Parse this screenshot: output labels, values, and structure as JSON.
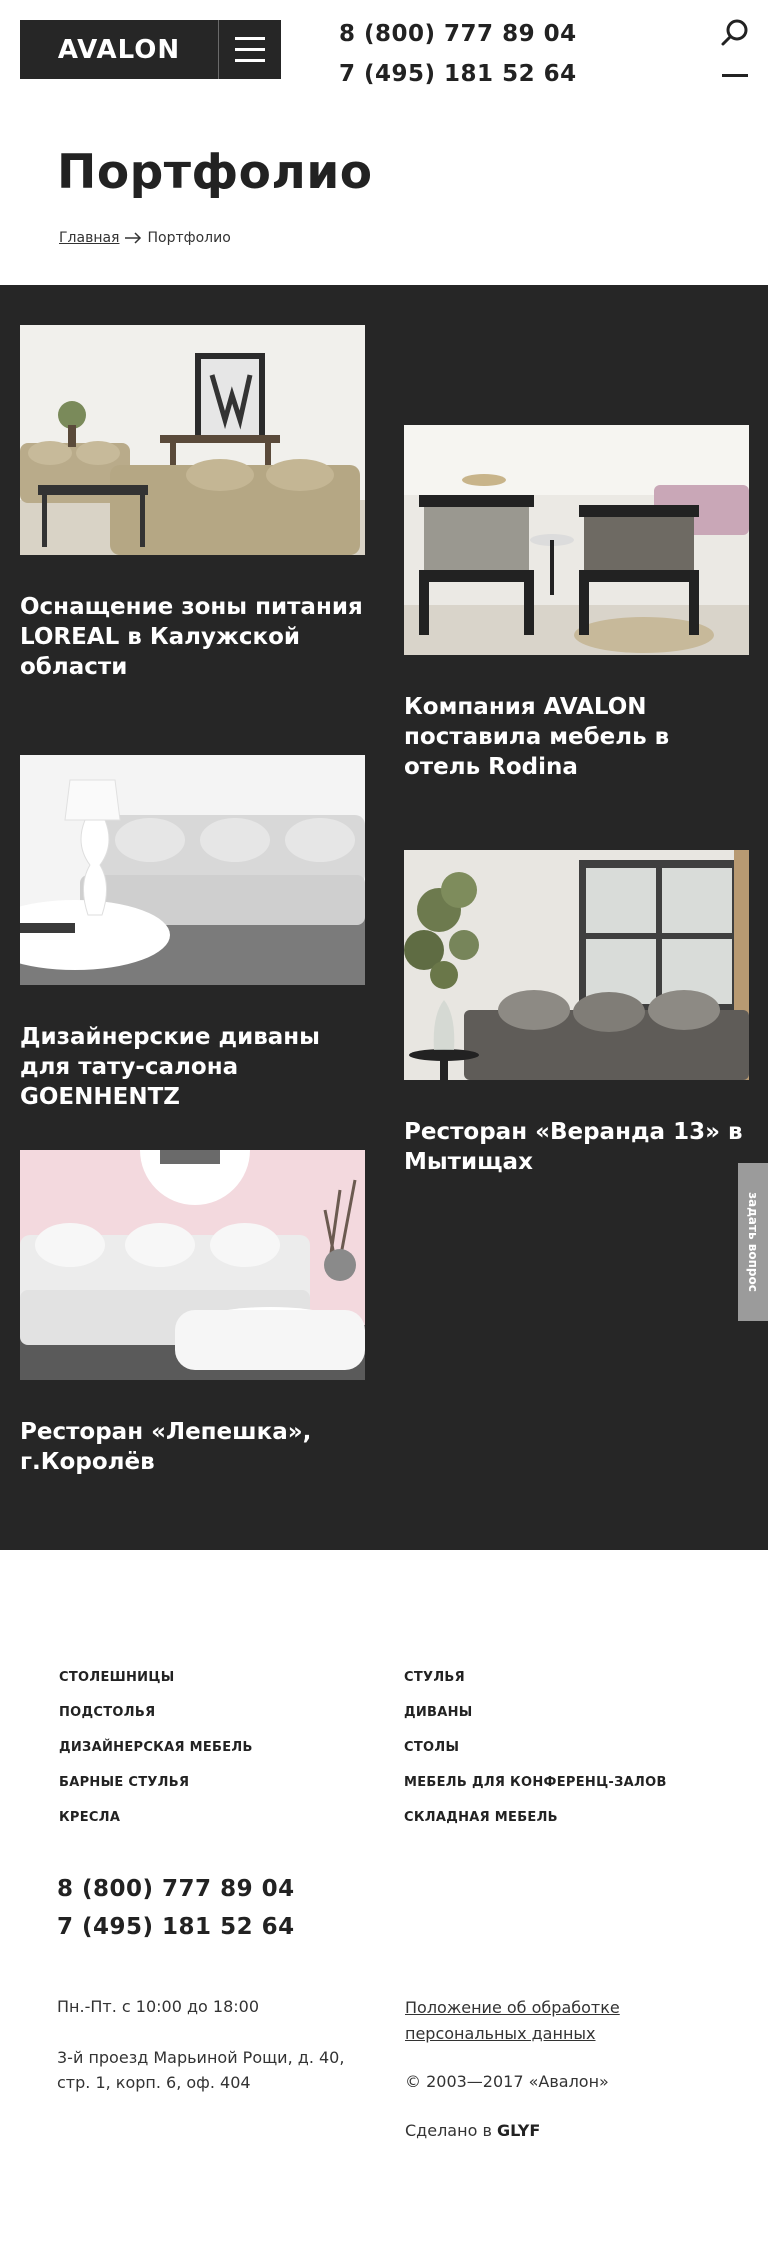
{
  "header": {
    "logo": "AVALON",
    "phones": [
      "8 (800) 777 89 04",
      "7 (495) 181 52 64"
    ],
    "icons": [
      "menu-icon",
      "search-icon"
    ]
  },
  "page": {
    "title": "Портфолио",
    "breadcrumb": {
      "home": "Главная",
      "current": "Портфолио"
    }
  },
  "portfolio": {
    "items": [
      {
        "title": "Оснащение зоны питания LOREAL в Калужской области"
      },
      {
        "title": "Компания AVALON поставила мебель в отель Rodina"
      },
      {
        "title": "Дизайнерские диваны для тату-салона GOENHENTZ"
      },
      {
        "title": "Ресторан «Веранда 13» в Мытищах"
      },
      {
        "title": "Ресторан «Лепешка», г.Королёв"
      }
    ],
    "side_tab": "задать вопрос"
  },
  "footer": {
    "nav_left": [
      "СТОЛЕШНИЦЫ",
      "ПОДСТОЛЬЯ",
      "ДИЗАЙНЕРСКАЯ МЕБЕЛЬ",
      "БАРНЫЕ СТУЛЬЯ",
      "КРЕСЛА"
    ],
    "nav_right": [
      "СТУЛЬЯ",
      "ДИВАНЫ",
      "СТОЛЫ",
      "МЕБЕЛЬ ДЛЯ КОНФЕРЕНЦ-ЗАЛОВ",
      "СКЛАДНАЯ МЕБЕЛЬ"
    ],
    "phones": [
      "8 (800) 777 89 04",
      "7 (495) 181 52 64"
    ],
    "hours": "Пн.-Пт. с 10:00 до 18:00",
    "address": "3-й проезд Марьиной Рощи, д. 40, стр. 1, корп. 6, оф. 404",
    "policy": "Положение об обработке персональных данных",
    "copyright": "© 2003—2017 «Авалон»",
    "made_in_label": "Сделано в",
    "made_in_brand": "GLYF"
  },
  "colors": {
    "dark_section": "#262626",
    "side_tab": "#9b9b9b",
    "text": "#222222"
  }
}
